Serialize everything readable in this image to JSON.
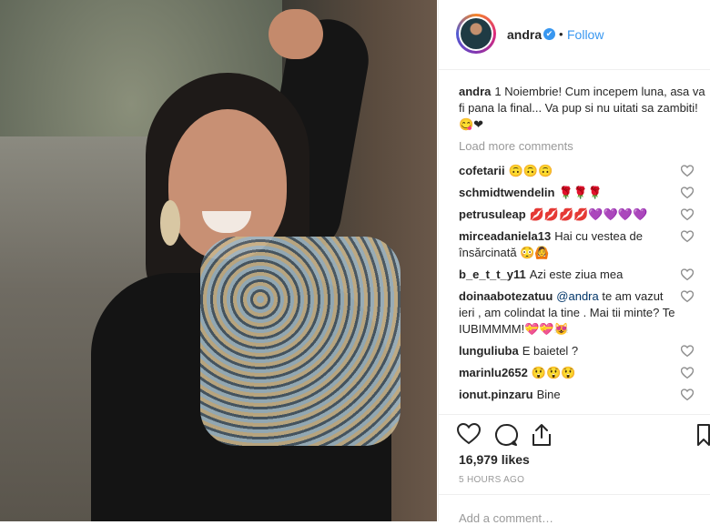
{
  "header": {
    "username": "andra",
    "verified_mark": "✔",
    "separator": "•",
    "follow_label": "Follow"
  },
  "caption": {
    "username": "andra",
    "text": "1 Noiembrie! Cum incepem luna, asa va fi pana la final... Va pup si nu uitati sa zambiti! 😋❤"
  },
  "load_more_label": "Load more comments",
  "comments": [
    {
      "user": "cofetarii",
      "text": "🙃🙃🙃"
    },
    {
      "user": "schmidtwendelin",
      "text": "🌹🌹🌹"
    },
    {
      "user": "petrusuleap",
      "text": "💋💋💋💋💜💜💜💜"
    },
    {
      "user": "mirceadaniela13",
      "text": "Hai cu vestea de însărcinată 😳🙆"
    },
    {
      "user": "b_e_t_t_y11",
      "text": "Azi este ziua mea"
    },
    {
      "user": "doinaabotezatuu",
      "mention": "@andra",
      "text": " te am vazut ieri , am colindat la tine . Mai tii minte? Te IUBIMMMM!💝💝😻"
    },
    {
      "user": "lunguliuba",
      "text": "E baietel ?"
    },
    {
      "user": "marinlu2652",
      "text": "😲😲😲"
    },
    {
      "user": "ionut.pinzaru",
      "text": "Bine"
    }
  ],
  "likes_text": "16,979 likes",
  "time_ago": "5 HOURS AGO",
  "add_comment_placeholder": "Add a comment…",
  "icons": {
    "like": "heart-icon",
    "comment": "comment-icon",
    "share": "share-icon",
    "save": "bookmark-icon",
    "verified": "verified-badge-icon"
  },
  "colors": {
    "link": "#3897f0",
    "text": "#262626",
    "muted": "#999999",
    "verified": "#3897f0"
  }
}
